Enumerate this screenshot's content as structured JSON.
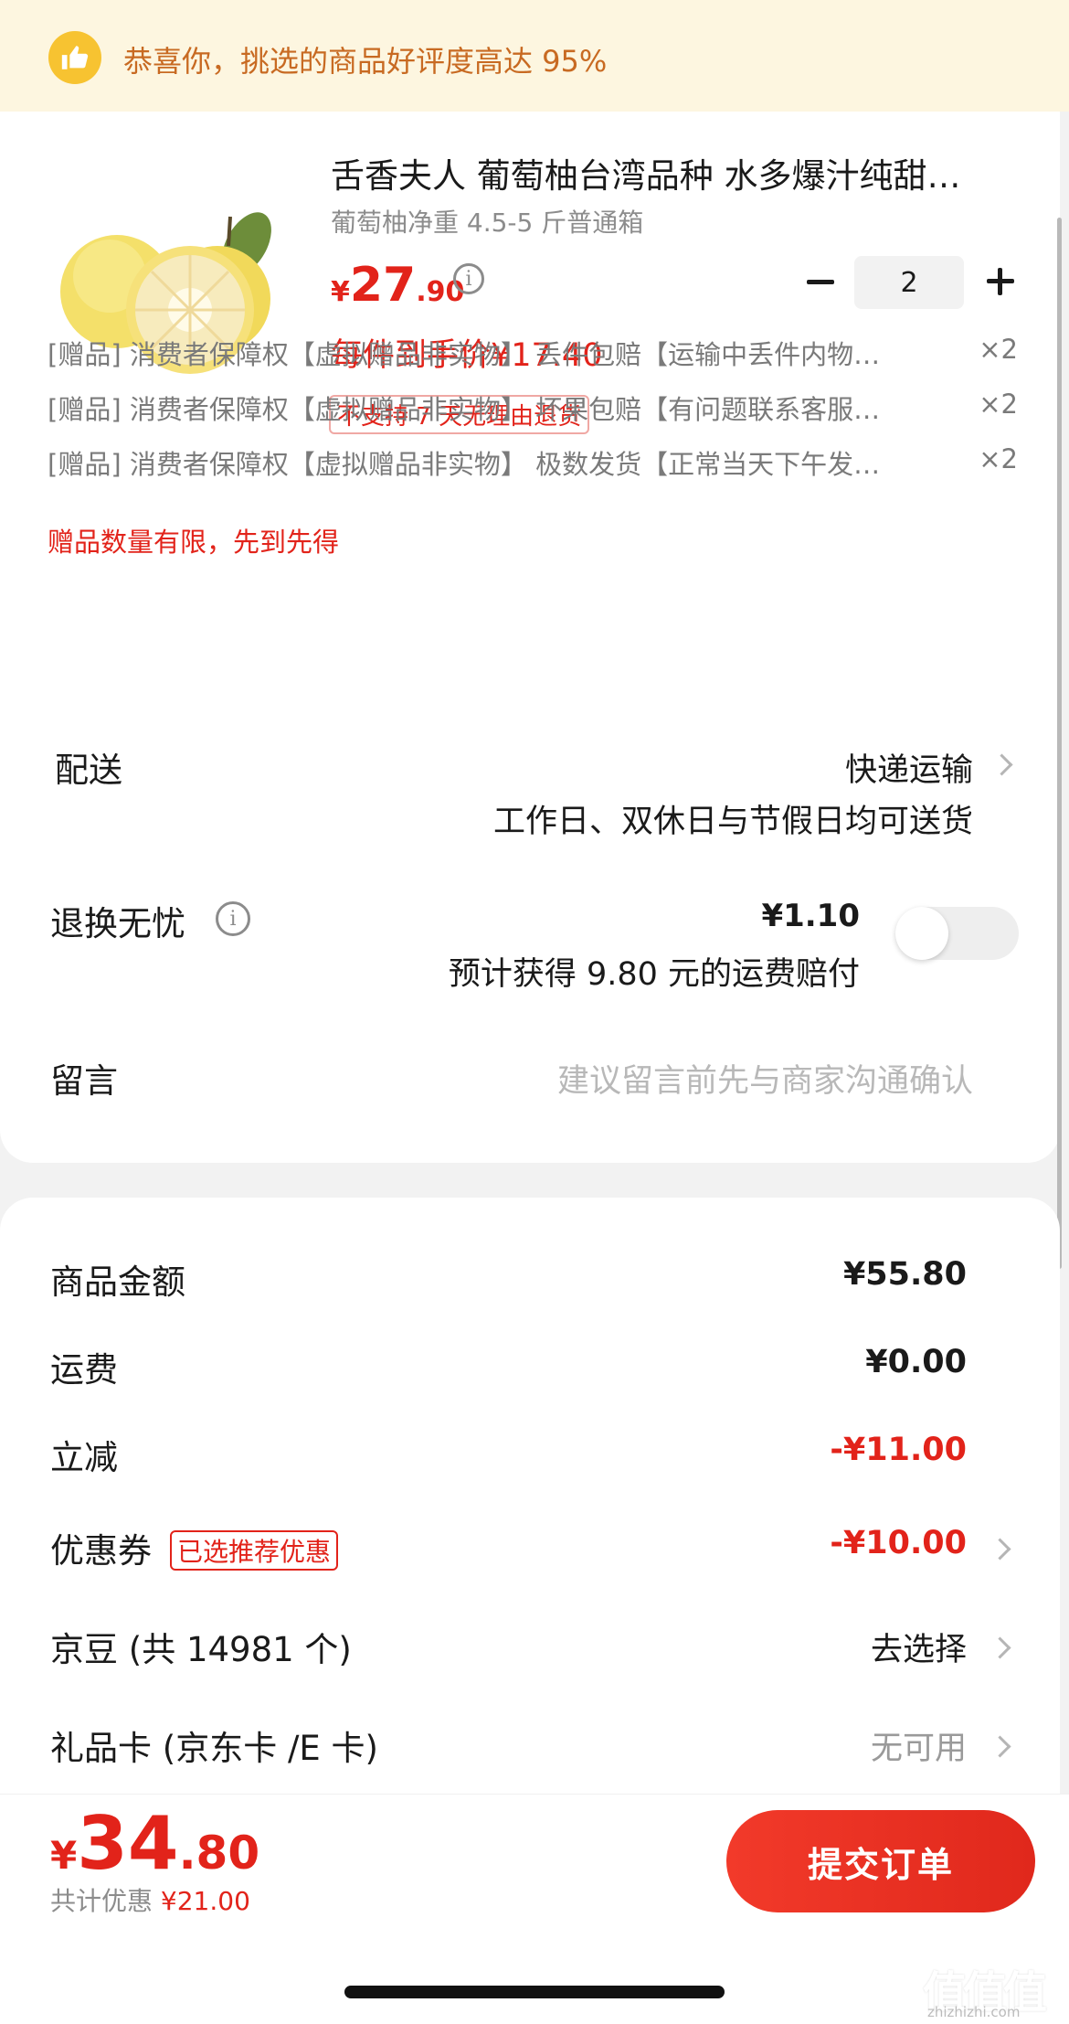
{
  "banner": {
    "icon": "thumbs-up-icon",
    "text": "恭喜你，挑选的商品好评度高达 95%"
  },
  "product": {
    "title": "舌香夫人 葡萄柚台湾品种 水多爆汁纯甜…",
    "spec": "葡萄柚净重 4.5-5 斤普通箱",
    "price_currency": "¥",
    "price_int": "27",
    "price_dec": ".90",
    "unit_price": "每件到手价¥17.40",
    "return_tag": "不支持 7 天无理由退货",
    "quantity": "2"
  },
  "gifts": [
    {
      "text": "[赠品] 消费者保障权【虚拟赠品非实物】 丢件包赔【运输中丢件内物…",
      "qty": "×2"
    },
    {
      "text": "[赠品] 消费者保障权【虚拟赠品非实物】 坏果包赔【有问题联系客服…",
      "qty": "×2"
    },
    {
      "text": "[赠品] 消费者保障权【虚拟赠品非实物】 极数发货【正常当天下午发…",
      "qty": "×2"
    }
  ],
  "gift_note": "赠品数量有限，先到先得",
  "delivery": {
    "label": "配送",
    "method": "快递运输",
    "note": "工作日、双休日与节假日均可送货"
  },
  "return_insurance": {
    "label": "退换无忧",
    "price": "¥1.10",
    "note": "预计获得 9.80 元的运费赔付",
    "enabled": false
  },
  "message": {
    "label": "留言",
    "placeholder": "建议留言前先与商家沟通确认"
  },
  "summary": {
    "goods_label": "商品金额",
    "goods_value": "¥55.80",
    "shipping_label": "运费",
    "shipping_value": "¥0.00",
    "discount_label": "立减",
    "discount_value": "-¥11.00",
    "coupon_label": "优惠券",
    "coupon_tag": "已选推荐优惠",
    "coupon_value": "-¥10.00",
    "beans_label": "京豆 (共 14981 个)",
    "beans_value": "去选择",
    "giftcard_label": "礼品卡 (京东卡 /E 卡)",
    "giftcard_value": "无可用"
  },
  "footer": {
    "total_currency": "¥",
    "total_int": "34",
    "total_dec": ".80",
    "saved_prefix": "共计优惠 ",
    "saved_amount": "¥21.00",
    "submit_label": "提交订单"
  },
  "watermark": {
    "text": "值值值",
    "sub": "zhizhizhi.com"
  },
  "colors": {
    "accent": "#e2231a",
    "banner_bg": "#fdf6e0",
    "banner_text": "#c86a22"
  }
}
